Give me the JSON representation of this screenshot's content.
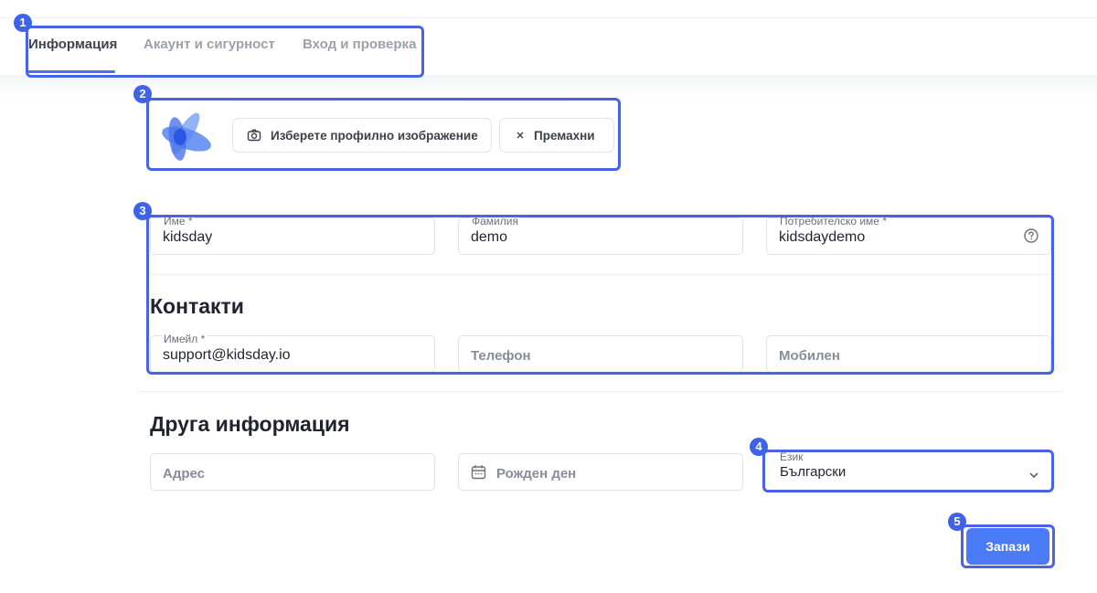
{
  "tabs": [
    {
      "label": "Информация",
      "active": true
    },
    {
      "label": "Акаунт и сигурност",
      "active": false
    },
    {
      "label": "Вход и проверка",
      "active": false
    }
  ],
  "profile": {
    "choose_image_label": "Изберете профилно изображение",
    "remove_label": "Премахни"
  },
  "fields": {
    "first_name": {
      "label": "Име *",
      "value": "kidsday"
    },
    "last_name": {
      "label": "Фамилия",
      "value": "demo"
    },
    "username": {
      "label": "Потребителско име *",
      "value": "kidsdaydemo"
    },
    "email": {
      "label": "Имейл *",
      "value": "support@kidsday.io"
    },
    "phone": {
      "placeholder": "Телефон"
    },
    "mobile": {
      "placeholder": "Мобилен"
    },
    "address": {
      "placeholder": "Адрес"
    },
    "birthday": {
      "placeholder": "Рожден ден"
    },
    "language": {
      "label": "Език",
      "value": "Български"
    }
  },
  "sections": {
    "contacts": "Контакти",
    "other": "Друга информация"
  },
  "save_label": "Запази",
  "annotations": [
    "1",
    "2",
    "3",
    "4",
    "5"
  ],
  "colors": {
    "accent": "#4a6cf7",
    "highlight": "#4a62e6",
    "save": "#4a7af5"
  }
}
